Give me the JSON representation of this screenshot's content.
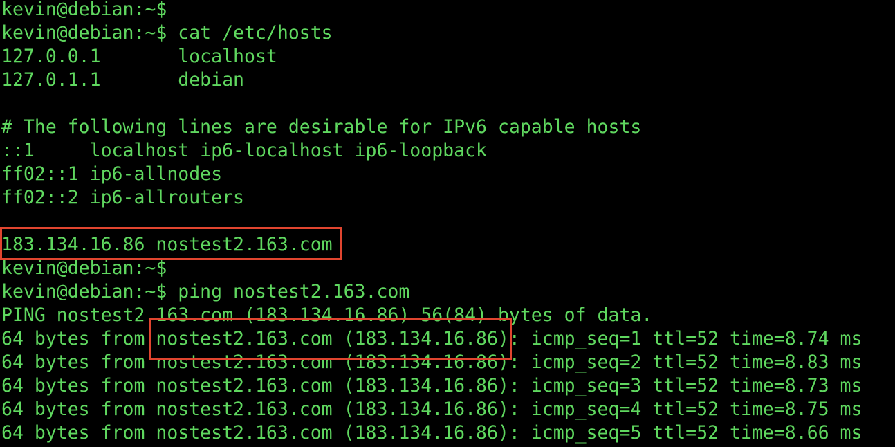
{
  "terminal": {
    "colors": {
      "background": "#000000",
      "text": "#5fd75f",
      "highlight": "#e0452f"
    },
    "lines": [
      "kevin@debian:~$",
      "kevin@debian:~$ cat /etc/hosts",
      "127.0.0.1       localhost",
      "127.0.1.1       debian",
      "",
      "# The following lines are desirable for IPv6 capable hosts",
      "::1     localhost ip6-localhost ip6-loopback",
      "ff02::1 ip6-allnodes",
      "ff02::2 ip6-allrouters",
      "",
      "183.134.16.86 nostest2.163.com",
      "kevin@debian:~$",
      "kevin@debian:~$ ping nostest2.163.com",
      "PING nostest2.163.com (183.134.16.86) 56(84) bytes of data.",
      "64 bytes from nostest2.163.com (183.134.16.86): icmp_seq=1 ttl=52 time=8.74 ms",
      "64 bytes from nostest2.163.com (183.134.16.86): icmp_seq=2 ttl=52 time=8.83 ms",
      "64 bytes from nostest2.163.com (183.134.16.86): icmp_seq=3 ttl=52 time=8.73 ms",
      "64 bytes from nostest2.163.com (183.134.16.86): icmp_seq=4 ttl=52 time=8.75 ms",
      "64 bytes from nostest2.163.com (183.134.16.86): icmp_seq=5 ttl=52 time=8.66 ms"
    ]
  }
}
